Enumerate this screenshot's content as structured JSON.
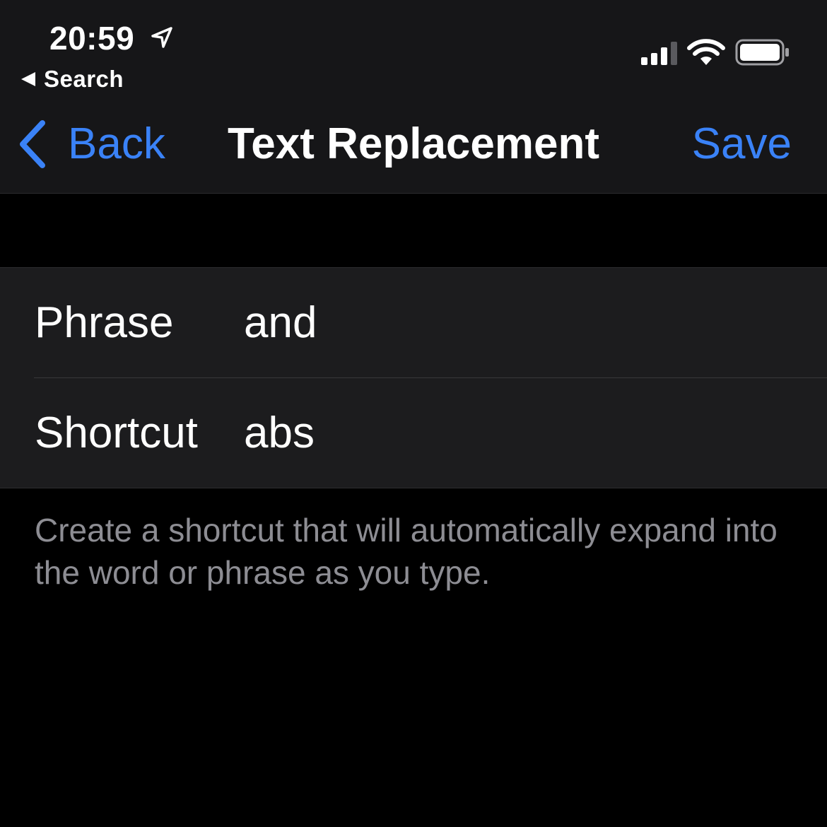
{
  "status_bar": {
    "time": "20:59",
    "back_to_app": "Search",
    "icons": [
      "location-arrow-icon",
      "cellular-signal-icon",
      "wifi-icon",
      "battery-icon"
    ]
  },
  "nav": {
    "back_label": "Back",
    "title": "Text Replacement",
    "save_label": "Save"
  },
  "form": {
    "rows": [
      {
        "label": "Phrase",
        "value": "and"
      },
      {
        "label": "Shortcut",
        "value": "abs"
      }
    ]
  },
  "footer": {
    "note": "Create a shortcut that will automatically expand into the word or phrase as you type."
  },
  "colors": {
    "accent": "#3a82f7",
    "background": "#000000",
    "header_background": "#161618",
    "cell_background": "#1c1c1e",
    "secondary_text": "#8d8d93"
  }
}
